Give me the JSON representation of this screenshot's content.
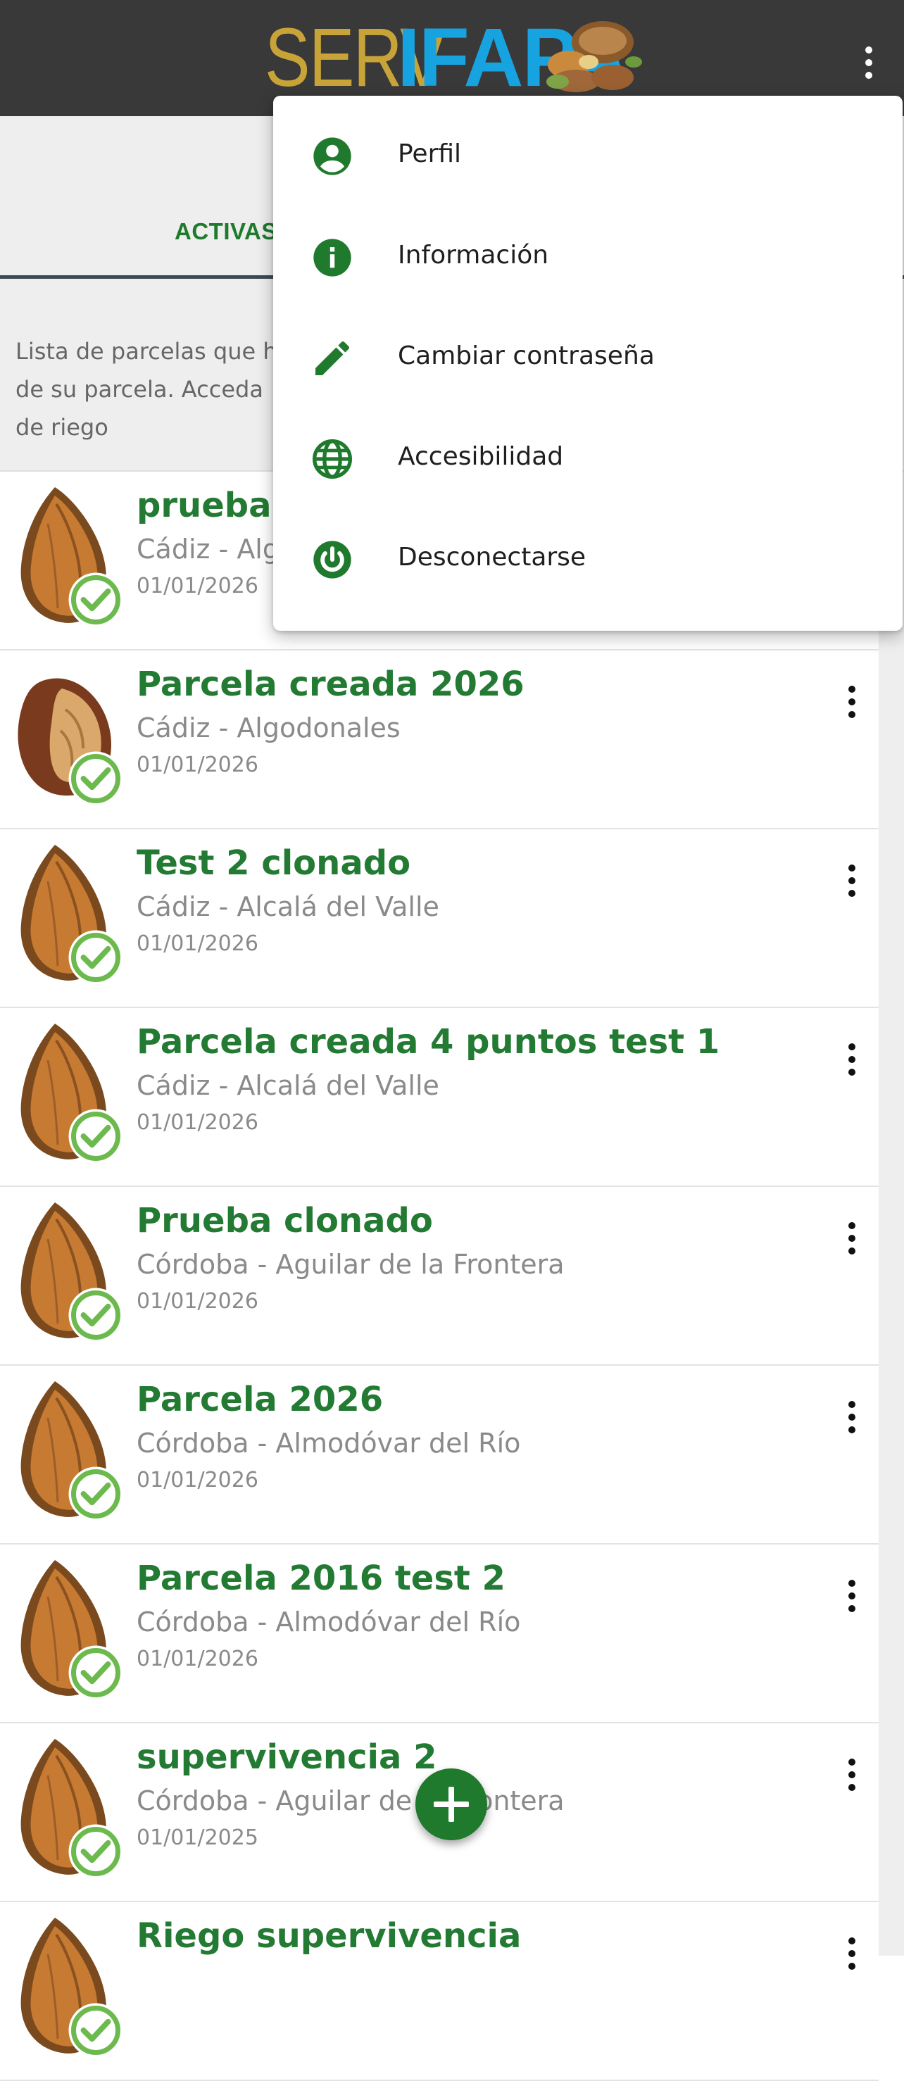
{
  "app": {
    "logo_part1": "SERV",
    "logo_part2": "IFAPA",
    "accent_color": "#1f7a2d",
    "header_color": "#393939"
  },
  "tabs": [
    {
      "label": "ACTIVAS",
      "active": true
    }
  ],
  "intro_text": "Lista de parcelas que ha de su parcela. Acceda de riego",
  "intro_lines": [
    "Lista de parcelas que ha",
    "de su parcela. Acceda",
    "de riego"
  ],
  "parcels": [
    {
      "title": "prueba",
      "location": "Cádiz - Alg",
      "date": "01/01/2026",
      "crop_icon": "almond-icon",
      "status": "check-icon"
    },
    {
      "title": "Parcela creada 2026",
      "location": "Cádiz - Algodonales",
      "date": "01/01/2026",
      "crop_icon": "walnut-icon",
      "status": "check-icon"
    },
    {
      "title": "Test 2 clonado",
      "location": "Cádiz - Alcalá del Valle",
      "date": "01/01/2026",
      "crop_icon": "almond-icon",
      "status": "check-icon"
    },
    {
      "title": "Parcela creada 4 puntos test 1",
      "location": "Cádiz - Alcalá del Valle",
      "date": "01/01/2026",
      "crop_icon": "almond-icon",
      "status": "check-icon"
    },
    {
      "title": "Prueba clonado",
      "location": "Córdoba - Aguilar de la Frontera",
      "date": "01/01/2026",
      "crop_icon": "almond-icon",
      "status": "check-icon"
    },
    {
      "title": "Parcela 2026",
      "location": "Córdoba - Almodóvar del Río",
      "date": "01/01/2026",
      "crop_icon": "almond-icon",
      "status": "check-icon"
    },
    {
      "title": "Parcela 2016 test 2",
      "location": "Córdoba - Almodóvar del Río",
      "date": "01/01/2026",
      "crop_icon": "almond-icon",
      "status": "check-icon"
    },
    {
      "title": "supervivencia 2",
      "location": "Córdoba - Aguilar de la Frontera",
      "date": "01/01/2025",
      "crop_icon": "almond-icon",
      "status": "check-icon"
    },
    {
      "title": "Riego supervivencia",
      "location": "",
      "date": "",
      "crop_icon": "almond-icon",
      "status": "check-icon"
    }
  ],
  "menu": [
    {
      "label": "Perfil",
      "icon": "account-circle-icon"
    },
    {
      "label": "Información",
      "icon": "info-icon"
    },
    {
      "label": "Cambiar contraseña",
      "icon": "pencil-icon"
    },
    {
      "label": "Accesibilidad",
      "icon": "globe-icon"
    },
    {
      "label": "Desconectarse",
      "icon": "power-icon"
    }
  ],
  "fab": {
    "icon": "plus-icon"
  }
}
